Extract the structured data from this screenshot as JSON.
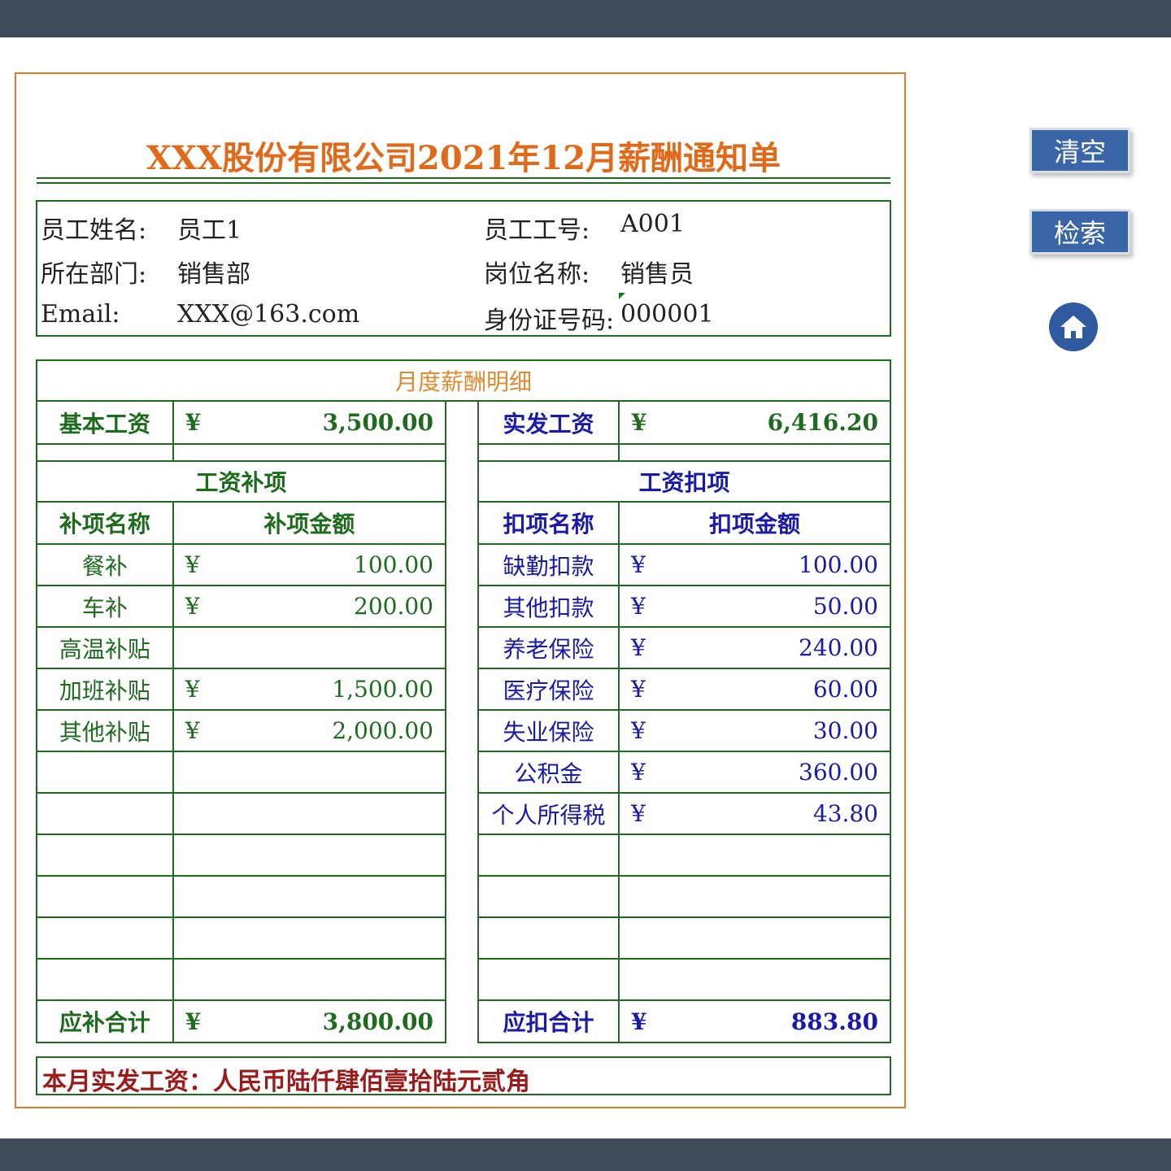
{
  "colors": {
    "chrome_bar": "#3e4a5a",
    "frame_border": "#e07b2a",
    "title": "#e06a1a",
    "section_title": "#e08a30",
    "green_text": "#1e6b1e",
    "blue_text": "#1a1aa8",
    "footer_text": "#9b1b1b",
    "button_bg": "#3a66a8",
    "home_bg": "#2f5aa0"
  },
  "title": "XXX股份有限公司2021年12月薪酬通知单",
  "info": {
    "name_label": "员工姓名:",
    "name_value": "员工1",
    "id_label": "员工工号:",
    "id_value": "A001",
    "dept_label": "所在部门:",
    "dept_value": "销售部",
    "position_label": "岗位名称:",
    "position_value": "销售员",
    "email_label": "Email:",
    "email_value": "XXX@163.com",
    "idcard_label": "身份证号码:",
    "idcard_value": "000001"
  },
  "monthly": {
    "section_title": "月度薪酬明细",
    "base_label": "基本工资",
    "base_currency": "¥",
    "base_value": "3,500.00",
    "net_label": "实发工资",
    "net_currency": "¥",
    "net_value": "6,416.20"
  },
  "allowances": {
    "title": "工资补项",
    "col_name": "补项名称",
    "col_amount": "补项金额",
    "rows": [
      {
        "name": "餐补",
        "currency": "¥",
        "amount": "100.00"
      },
      {
        "name": "车补",
        "currency": "¥",
        "amount": "200.00"
      },
      {
        "name": "高温补贴",
        "currency": "",
        "amount": ""
      },
      {
        "name": "加班补贴",
        "currency": "¥",
        "amount": "1,500.00"
      },
      {
        "name": "其他补贴",
        "currency": "¥",
        "amount": "2,000.00"
      },
      {
        "name": "",
        "currency": "",
        "amount": ""
      },
      {
        "name": "",
        "currency": "",
        "amount": ""
      },
      {
        "name": "",
        "currency": "",
        "amount": ""
      },
      {
        "name": "",
        "currency": "",
        "amount": ""
      },
      {
        "name": "",
        "currency": "",
        "amount": ""
      },
      {
        "name": "",
        "currency": "",
        "amount": ""
      }
    ],
    "total_label": "应补合计",
    "total_currency": "¥",
    "total_value": "3,800.00"
  },
  "deductions": {
    "title": "工资扣项",
    "col_name": "扣项名称",
    "col_amount": "扣项金额",
    "rows": [
      {
        "name": "缺勤扣款",
        "currency": "¥",
        "amount": "100.00"
      },
      {
        "name": "其他扣款",
        "currency": "¥",
        "amount": "50.00"
      },
      {
        "name": "养老保险",
        "currency": "¥",
        "amount": "240.00"
      },
      {
        "name": "医疗保险",
        "currency": "¥",
        "amount": "60.00"
      },
      {
        "name": "失业保险",
        "currency": "¥",
        "amount": "30.00"
      },
      {
        "name": "公积金",
        "currency": "¥",
        "amount": "360.00"
      },
      {
        "name": "个人所得税",
        "currency": "¥",
        "amount": "43.80"
      },
      {
        "name": "",
        "currency": "",
        "amount": ""
      },
      {
        "name": "",
        "currency": "",
        "amount": ""
      },
      {
        "name": "",
        "currency": "",
        "amount": ""
      },
      {
        "name": "",
        "currency": "",
        "amount": ""
      }
    ],
    "total_label": "应扣合计",
    "total_currency": "¥",
    "total_value": "883.80"
  },
  "footer": {
    "text": "本月实发工资：人民币陆仟肆佰壹拾陆元贰角"
  },
  "buttons": {
    "clear_label": "清空",
    "search_label": "检索",
    "home_icon": "home-icon"
  }
}
